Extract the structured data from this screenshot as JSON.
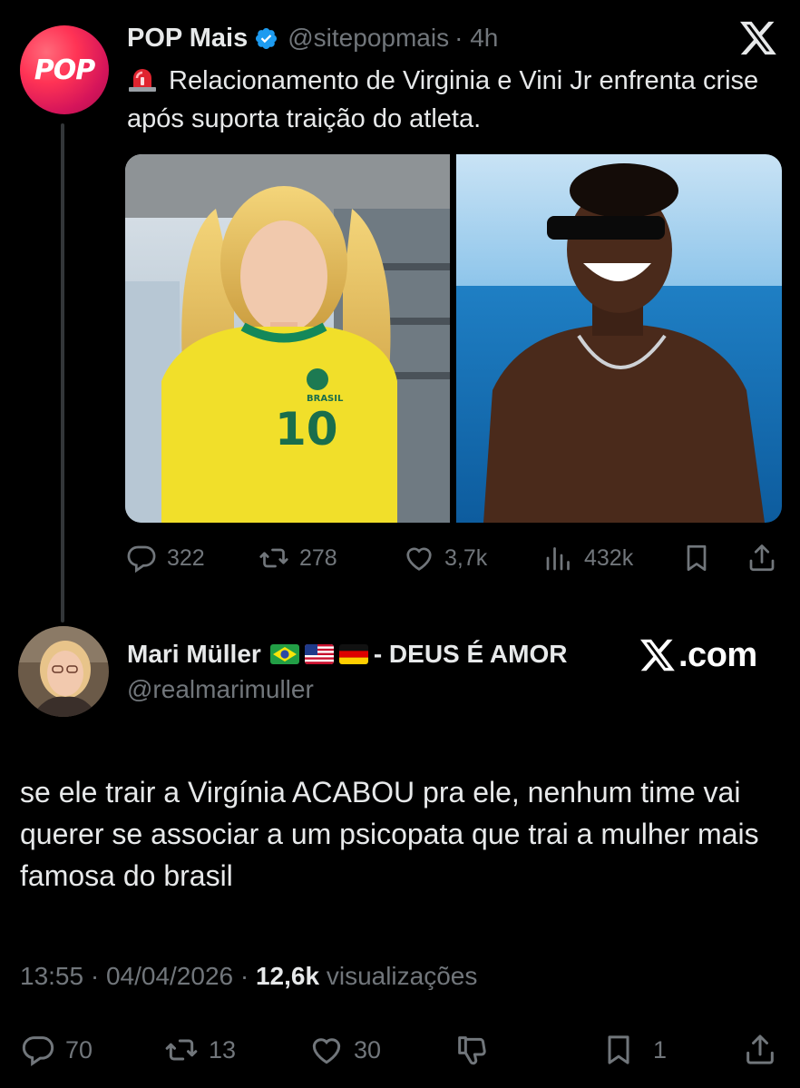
{
  "parent_tweet": {
    "name": "POP Mais",
    "handle": "@sitepopmais",
    "time": "· 4h",
    "avatar_text": "POP",
    "text": "Relacionamento de Virginia e Vini Jr enfrenta crise após suporta traição do atleta.",
    "emoji_icon": "police-siren-icon",
    "media_left_jersey_number": "10",
    "media_left_jersey_text": "BRASIL",
    "stats": {
      "replies": "322",
      "reposts": "278",
      "likes": "3,7k",
      "views": "432k"
    }
  },
  "reply_tweet": {
    "name": "Mari Müller",
    "flags": [
      "brazil-flag-icon",
      "usa-flag-icon",
      "germany-flag-icon"
    ],
    "tagline": "- DEUS É AMOR",
    "handle": "@realmarimuller",
    "watermark": ".com",
    "text": "se ele trair a Virgínia ACABOU pra ele, nenhum time vai querer se associar a um psicopata que trai a mulher mais famosa do brasil",
    "meta_time": "13:55 · 04/04/2026 · ",
    "meta_views": "12,6k",
    "meta_views_label": " visualizações",
    "stats": {
      "replies": "70",
      "reposts": "13",
      "likes": "30",
      "bookmarks": "1"
    }
  },
  "colors": {
    "background": "#000000",
    "text": "#e7e9ea",
    "muted": "#71767b",
    "verified": "#1d9bf0",
    "thread_line": "#333639"
  }
}
